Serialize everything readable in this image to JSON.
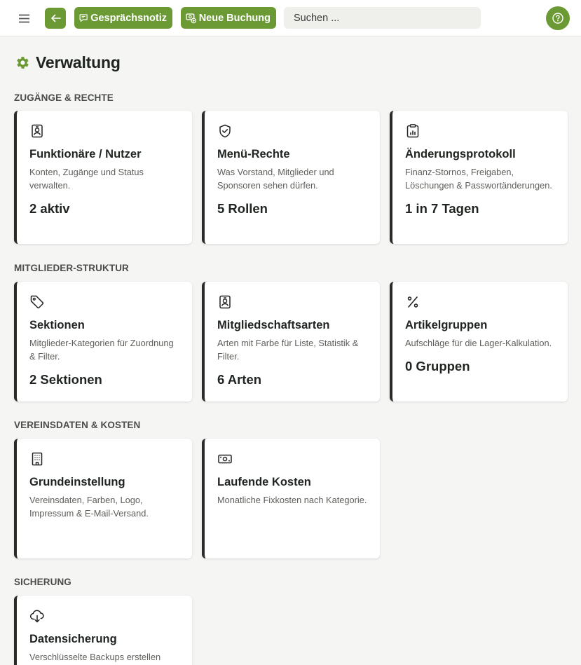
{
  "topbar": {
    "notiz_label": "Gesprächsnotiz",
    "buchung_label": "Neue Buchung",
    "search_placeholder": "Suchen ..."
  },
  "page": {
    "title": "Verwaltung"
  },
  "colors": {
    "accent": "#6b9a34",
    "card_border": "#2a2c29",
    "background": "#f5f5f4"
  },
  "sections": [
    {
      "label": "ZUGÄNGE & RECHTE",
      "cards": [
        {
          "icon": "id-badge-icon",
          "title": "Funktionäre / Nutzer",
          "desc": "Konten, Zugänge und Status verwalten.",
          "stat": "2 aktiv"
        },
        {
          "icon": "shield-check-icon",
          "title": "Menü-Rechte",
          "desc": "Was Vorstand, Mitglieder und Sponsoren sehen dürfen.",
          "stat": "5 Rollen"
        },
        {
          "icon": "clipboard-chart-icon",
          "title": "Änderungsprotokoll",
          "desc": "Finanz-Stornos, Freigaben, Löschungen & Passwortänderungen.",
          "stat": "1 in 7 Tagen"
        }
      ]
    },
    {
      "label": "MITGLIEDER-STRUKTUR",
      "cards": [
        {
          "icon": "tag-icon",
          "title": "Sektionen",
          "desc": "Mitglieder-Kategorien für Zuordnung & Filter.",
          "stat": "2 Sektionen"
        },
        {
          "icon": "id-badge-icon",
          "title": "Mitgliedschaftsarten",
          "desc": "Arten mit Farbe für Liste, Statistik & Filter.",
          "stat": "6 Arten"
        },
        {
          "icon": "percent-icon",
          "title": "Artikelgruppen",
          "desc": "Aufschläge für die Lager-Kalkulation.",
          "stat": "0 Gruppen"
        }
      ]
    },
    {
      "label": "VEREINSDATEN & KOSTEN",
      "cards": [
        {
          "icon": "building-icon",
          "title": "Grundeinstellung",
          "desc": "Vereinsdaten, Farben, Logo, Impressum & E-Mail-Versand.",
          "stat": ""
        },
        {
          "icon": "banknote-icon",
          "title": "Laufende Kosten",
          "desc": "Monatliche Fixkosten nach Kategorie.",
          "stat": ""
        }
      ]
    },
    {
      "label": "SICHERUNG",
      "cards": [
        {
          "icon": "cloud-download-icon",
          "title": "Datensicherung",
          "desc": "Verschlüsselte Backups erstellen",
          "stat": ""
        }
      ]
    }
  ]
}
